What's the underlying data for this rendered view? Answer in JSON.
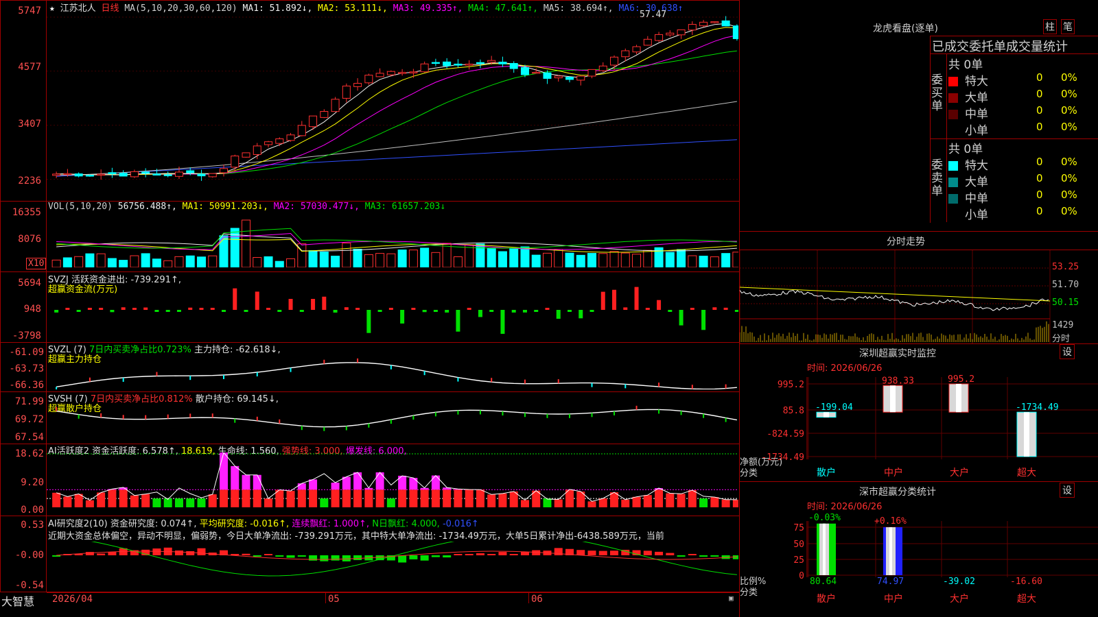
{
  "app": {
    "name": "大智慧"
  },
  "stock": {
    "name": "江苏北人",
    "period": "日线"
  },
  "main_panel": {
    "ma_label": "MA(5,10,20,30,60,120)",
    "ma1": "MA1: 51.892↓,",
    "ma2": "MA2: 53.111↓,",
    "ma3": "MA3: 49.335↑,",
    "ma4": "MA4: 47.641↑,",
    "ma5": "MA5: 38.694↑,",
    "ma6": "MA6: 30.638↑",
    "high_label": "57.47",
    "y_ticks": [
      "5747",
      "4577",
      "3407",
      "2236"
    ]
  },
  "vol_panel": {
    "label": "VOL(5,10,20)",
    "value": "56756.488↑,",
    "ma1": "MA1: 50991.203↓,",
    "ma2": "MA2: 57030.477↓,",
    "ma3": "MA3: 61657.203↓",
    "y_ticks": [
      "16355",
      "8076"
    ],
    "unit": "X10"
  },
  "svzj_panel": {
    "label": "SVZJ  活跃资金进出: -739.291↑,",
    "sub": "超赢资金流(万元)",
    "y_ticks": [
      "5694",
      "948",
      "-3798"
    ]
  },
  "svzl_panel": {
    "label": "SVZL (7)",
    "ratio": "7日内买卖净占比0.723%",
    "value": "主力持仓: -62.618↓,",
    "sub": "超赢主力持仓",
    "y_ticks": [
      "-61.09",
      "-63.73",
      "-66.36"
    ]
  },
  "svsh_panel": {
    "label": "SVSH (7)",
    "ratio": "7日内买卖净占比0.812%",
    "value": "散户持仓: 69.145↓,",
    "sub": "超赢散户持仓",
    "y_ticks": [
      "71.99",
      "69.72",
      "67.54"
    ]
  },
  "ai1_panel": {
    "label": "AI活跃度2 资金活跃度: 6.578↑,",
    "v2": "18.619,",
    "v3": "生命线: 1.560,",
    "v4": "强势线: 3.000,",
    "v5": "爆发线: 6.000,",
    "y_ticks": [
      "18.62",
      "9.20",
      "0.00"
    ]
  },
  "ai2_panel": {
    "label": "AI研究度2(10) 资金研究度: 0.074↑,",
    "v2": "平均研究度: -0.016↑,",
    "v3": "连续飘红: 1.000↑,",
    "v4": "N日飘红: 4.000,",
    "v5": "-0.016↑",
    "comment": "近期大资金总体偏空，异动不明显，偏弱势，今日大单净流出: -739.291万元，其中特大单净流出: -1734.49万元，大单5日累计净出-6438.589万元，当前",
    "y_ticks": [
      "0.53",
      "-0.00",
      "-0.54"
    ]
  },
  "x_axis": {
    "labels": [
      "2026/04",
      "05",
      "06"
    ]
  },
  "right": {
    "dragon": {
      "title": "龙虎看盘(逐单)",
      "btn1": "柱",
      "btn2": "笔",
      "sub": "已成交委托单成交量统计",
      "buy": {
        "side": "委买单",
        "total": "共 0单",
        "rows": [
          {
            "label": "特大",
            "count": "0",
            "pct": "0%",
            "color": "#ff0000"
          },
          {
            "label": "大单",
            "count": "0",
            "pct": "0%",
            "color": "#8b0000"
          },
          {
            "label": "中单",
            "count": "0",
            "pct": "0%",
            "color": "#5a0000"
          },
          {
            "label": "小单",
            "count": "0",
            "pct": "0%",
            "color": ""
          }
        ]
      },
      "sell": {
        "side": "委卖单",
        "total": "共 0单",
        "rows": [
          {
            "label": "特大",
            "count": "0",
            "pct": "0%",
            "color": "#00ffff"
          },
          {
            "label": "大单",
            "count": "0",
            "pct": "0%",
            "color": "#008b8b"
          },
          {
            "label": "中单",
            "count": "0",
            "pct": "0%",
            "color": "#006b6b"
          },
          {
            "label": "小单",
            "count": "0",
            "pct": "0%",
            "color": ""
          }
        ]
      }
    },
    "intraday": {
      "title": "分时走势",
      "y_ticks": [
        "53.25",
        "51.70",
        "50.15"
      ],
      "vol": "1429",
      "vol_label": "分时"
    },
    "monitor": {
      "title": "深圳超赢实时监控",
      "btn": "设",
      "time": "时间: 2026/06/26",
      "y_ticks": [
        "995.2",
        "85.8",
        "-824.59",
        "-1734.49"
      ],
      "y_title": "净额(万元)",
      "x_title": "分类",
      "categories": [
        "散户",
        "中户",
        "大户",
        "超大"
      ],
      "values": [
        -199.04,
        938.33,
        995.2,
        -1734.49
      ],
      "value_labels": [
        "-199.04",
        "938.33",
        "995.2",
        "-1734.49"
      ]
    },
    "classify": {
      "title": "深市超赢分类统计",
      "btn": "设",
      "time": "时间: 2026/06/26",
      "y_ticks": [
        "75",
        "50",
        "25",
        "0"
      ],
      "y_title": "比例%",
      "x_title": "分类",
      "categories": [
        "散户",
        "中户",
        "大户",
        "超大"
      ],
      "top_labels": [
        "-0.03%",
        "+0.16%"
      ],
      "bottom_values": [
        "80.64",
        "74.97",
        "-39.02",
        "-16.60"
      ]
    }
  },
  "colors": {
    "up": "#ff3030",
    "down": "#00ffff",
    "border": "#a00000",
    "green": "#00e000"
  }
}
